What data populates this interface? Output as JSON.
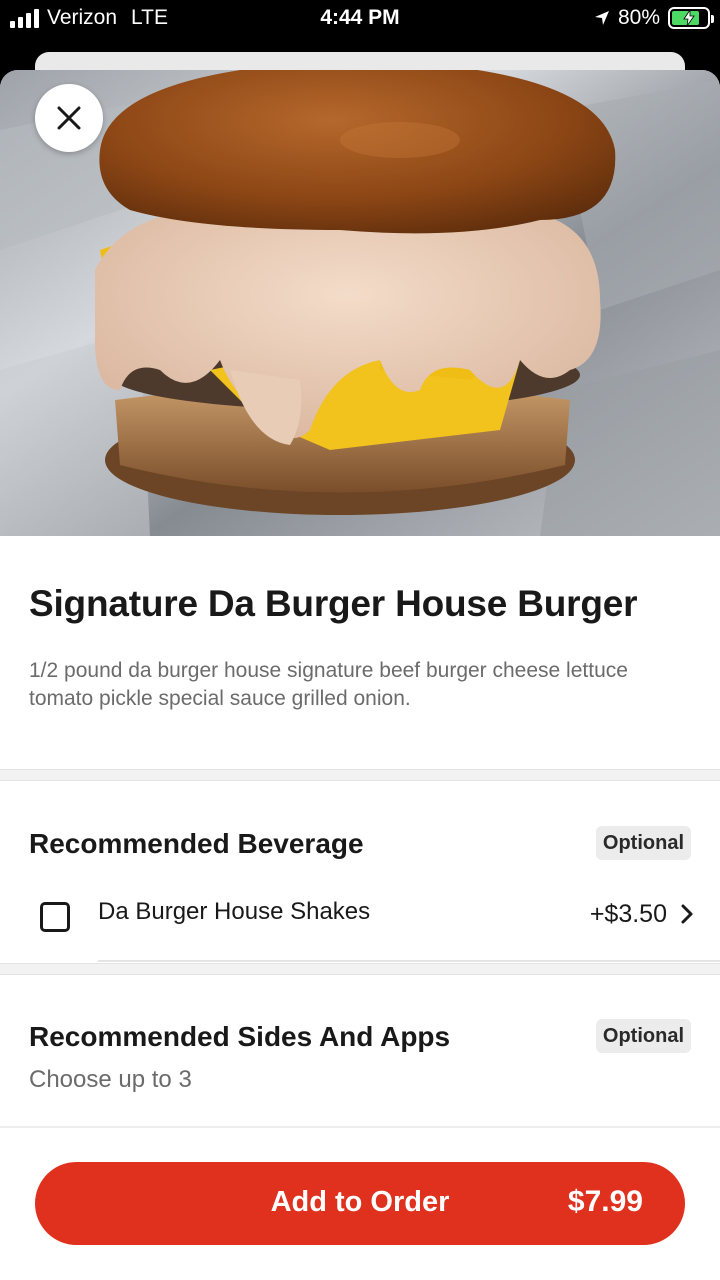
{
  "status_bar": {
    "carrier": "Verizon",
    "network": "LTE",
    "time": "4:44 PM",
    "battery": "80%",
    "battery_level": 0.8
  },
  "item": {
    "title": "Signature Da Burger House Burger",
    "description": "1/2 pound da burger house signature beef burger cheese lettuce tomato pickle special sauce grilled onion."
  },
  "sections": [
    {
      "title": "Recommended Beverage",
      "badge": "Optional",
      "options": [
        {
          "label": "Da Burger House Shakes",
          "price": "+$3.50",
          "checked": false
        }
      ]
    },
    {
      "title": "Recommended Sides And Apps",
      "badge": "Optional",
      "subtitle": "Choose up to 3"
    }
  ],
  "footer": {
    "button_label": "Add to Order",
    "price": "$7.99"
  },
  "colors": {
    "accent": "#e0301e",
    "status_bar_bg": "#000000"
  }
}
